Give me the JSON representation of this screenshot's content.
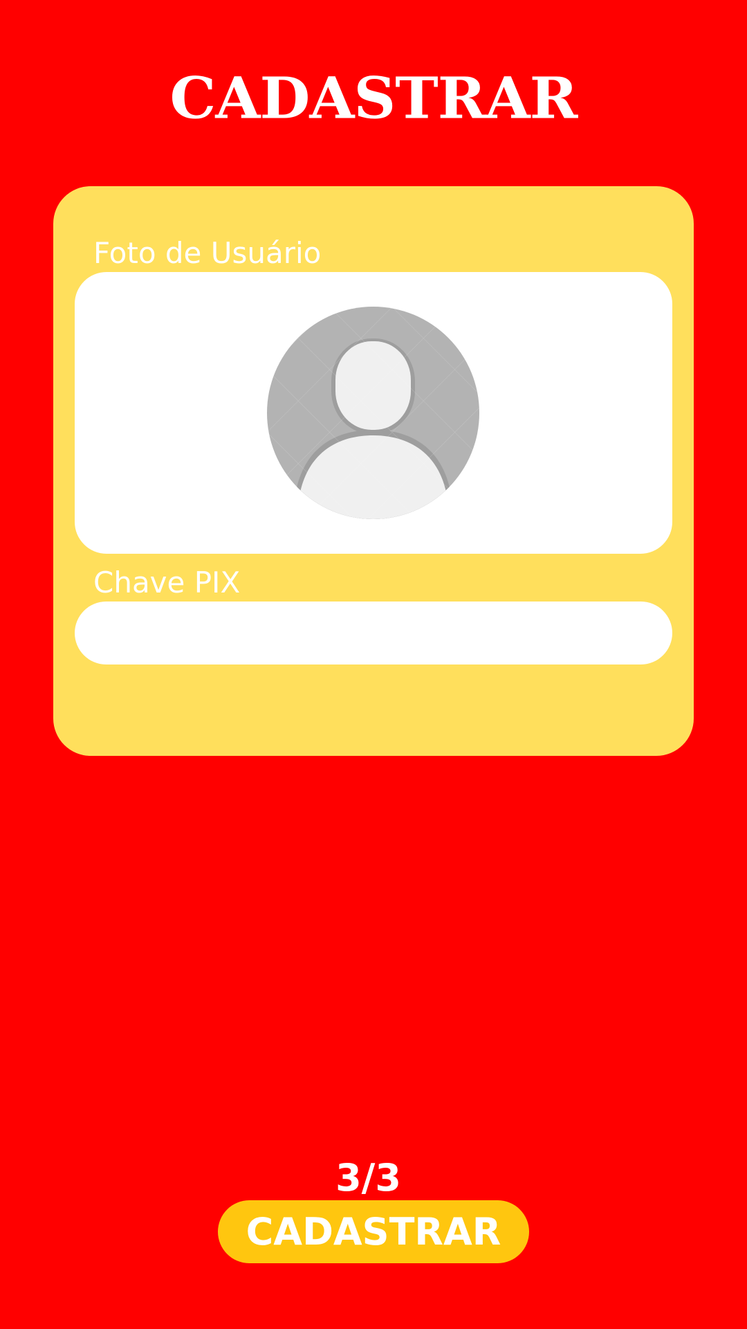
{
  "header": {
    "title": "CADASTRAR"
  },
  "form": {
    "photo_label": "Foto de Usuário",
    "avatar_icon": "user-placeholder-icon",
    "pix_label": "Chave PIX",
    "pix_value": "",
    "pix_placeholder": ""
  },
  "footer": {
    "step": "3/3",
    "submit_label": "CADASTRAR"
  },
  "colors": {
    "background": "#ff0000",
    "card": "#ffdf5c",
    "button": "#ffc60f",
    "field": "#ffffff",
    "avatar_bg": "#b3b3b3",
    "avatar_fg": "#f0f0f0"
  }
}
